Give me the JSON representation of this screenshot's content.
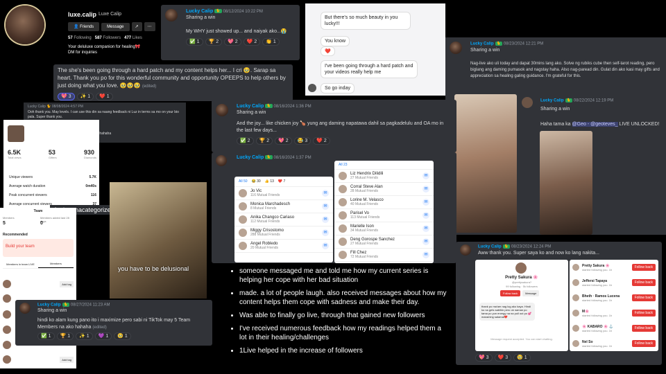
{
  "profile": {
    "handle": "luxe.calip",
    "display_name": "Luxe Calip",
    "friends_btn": "Friends",
    "message_btn": "Message",
    "following_count": "57",
    "following_label": "Following",
    "followers_count": "587",
    "followers_label": "Followers",
    "likes_count": "477",
    "likes_label": "Likes",
    "bio_line1": "Your deluluxe companion for healing🎀",
    "bio_line2": "DM for inquiries"
  },
  "comment1": {
    "text": "The she's been going through a hard patch and my content helps her... I cri 🥹. Sarap sa heart. Thank you po for this wonderful community and opportunity OPEEPS to help others by just doing what you love. 🥹🥹🥹",
    "edited": "(edited)",
    "reactions": [
      "💖 3",
      "✨ 1",
      "❤️ 1"
    ]
  },
  "post_top": {
    "user": "Lucky Calip",
    "badge": "🐈",
    "time": "08/12/2024 10:22 PM",
    "line1": "Sharing a win",
    "line2": "My WHY just showed up... and naiyak ako...😭",
    "reactions": [
      "✅ 1",
      "🏆 2",
      "💖 2",
      "❤️ 2",
      "👏 1"
    ]
  },
  "chat_white": {
    "msg1": "But there's so much beauty in you lucky!!!",
    "msg2": "You know",
    "msg3": "❤️",
    "msg4": "I've been going through a hard patch and your videos really help me",
    "msg5": "So go inday"
  },
  "post_right1": {
    "user": "Lucky Calip",
    "badge": "🐈",
    "time": "08/23/2024 12:21 PM",
    "line1": "Sharing a win",
    "line2": "Nag-live ako uli today and dapat 30mins lang ako. Solve ng rubiks cube then self-tarot reading, pero biglang ang daming pumasok and nagstay haha. Also nag-paread din. Gulat din ako kasi may gifts and appreciation sa healing galing guidance. I'm grateful for this."
  },
  "post_right2": {
    "user": "Lucky Calip",
    "badge": "🐈",
    "time": "08/22/2024 12:19 PM",
    "line1": "Sharing a win",
    "line2_a": "Haha tama ka ",
    "mention": "@Geo - @geoteves_",
    "line2_b": " LIVE UNLOCKED!"
  },
  "small_comment": {
    "title": "Lucky Calip 🐈 08/08/2024 4:57 PM",
    "line1": "Ooh thank you. May levels. I can use this din sa naang feedback ni Luz in terms sa mo on your bio pala. Super thank you.",
    "line2": "Sharing a win",
    "line3": "August thank you Live hahaha ganadong 3hrs hahaha"
  },
  "analytics": {
    "views": "6.5K",
    "views_label": "Total views",
    "gifters": "53",
    "gifters_label": "Gifters",
    "diamonds": "930",
    "diamonds_label": "Diamonds",
    "rows": [
      {
        "k": "Unique viewers",
        "v": "5.7K"
      },
      {
        "k": "Average watch duration",
        "v": "0m40s"
      },
      {
        "k": "Peak concurrent viewers",
        "v": "116"
      },
      {
        "k": "Average concurrent viewers",
        "v": "37"
      }
    ]
  },
  "delulu_caption": "And na nacategorize ka ring \"delulu\" hahaha",
  "team": {
    "title": "Team",
    "left_label": "Members",
    "left_value": "5",
    "right_label": "Members added last 28 days",
    "right_value": "0",
    "recommended": "Recommended",
    "build": "Build your team",
    "tab1": "Members in team LIVE",
    "tab2": "Members",
    "add_tag": "Add tag"
  },
  "video_caption": "you have to be delusional",
  "post_mid1": {
    "user": "Lucky Calip",
    "badge": "🐈",
    "time": "08/16/2024 1:36 PM",
    "line1": "Sharing a win",
    "line2": "And the joy... like chicken joy 🍗 yung ang daming napatawa dahil sa pagkadelulu and OA mo in the last few days...",
    "reactions": [
      "✅ 2",
      "🏆 2",
      "💖 2",
      "😂 3",
      "❤️ 2"
    ]
  },
  "post_mid2": {
    "user": "Lucky Calip",
    "badge": "🐈",
    "time": "08/16/2024 1:37 PM"
  },
  "fb_reacts": {
    "tabs": [
      "All 50",
      "😂 30",
      "👍 13",
      "❤️ 7"
    ],
    "left": [
      {
        "n": "Jo Vic",
        "m": "116 Mutual Friends"
      },
      {
        "n": "Monica Marchadesch",
        "m": "8 Mutual Friends"
      },
      {
        "n": "Anika Changco Cariaso",
        "m": "112 Mutual Friends"
      },
      {
        "n": "Miggy Crisostomo",
        "m": "288 Mutual Friends"
      },
      {
        "n": "Angel Robledo",
        "m": "20 Mutual Friends"
      }
    ],
    "right_tab": "All 23",
    "right": [
      {
        "n": "Liz Hendrix Dilidili",
        "m": "27 Mutual Friends"
      },
      {
        "n": "Corral Steve Alan",
        "m": "28 Mutual Friends"
      },
      {
        "n": "Lorine M. Velasco",
        "m": "40 Mutual Friends"
      },
      {
        "n": "Parisel Vo",
        "m": "113 Mutual Friends"
      },
      {
        "n": "Marielle Ison",
        "m": "34 Mutual Friends"
      },
      {
        "n": "Deng Gorospe Sanchez",
        "m": "27 Mutual Friends"
      },
      {
        "n": "Fill Chez",
        "m": "72 Mutual Friends"
      }
    ]
  },
  "bullets": [
    "someone messaged me and told me how my current series is helping her cope with her bad situation",
    "made. a lot of people laugh. also received messages about how my content helps them cope with sadness and make their day.",
    "Was able to finally go live, through that gained new followers",
    "I've received numerous feedback how my readings helped them a lot in their healing/challenges",
    "1Live helped in the increase of followers"
  ],
  "post_bottom": {
    "user": "Lucky Calip",
    "badge": "🐈",
    "time": "08/27/2024 11:23 AM",
    "line1": "Sharing a win",
    "line2": "hindi ko alam kung pano ito i maximize pero sabi ni TikTok may 5 Team Members na ako hahaha",
    "edited": "(edited)",
    "reactions": [
      "✅ 1",
      "🏆 1",
      "✨ 1",
      "💜 1",
      "🥹 1"
    ]
  },
  "post_right3": {
    "user": "Lucky Calip",
    "badge": "🐈",
    "time": "08/23/2024 12:24 PM",
    "line1": "Aww thank you. Super saya ko and now ko lang nakita...",
    "reactions": [
      "💖 3",
      "❤️ 3",
      "🥹 1"
    ]
  },
  "pretty": {
    "name": "Pretty Sakura 🌸",
    "handle": "@prettysakura?",
    "stats": "99 following · 5k followers",
    "btn1": "Follow back",
    "btn2": "Message",
    "chat": "thank po ma'am nag log ako kaya. Hindi ko na gets sabihin pero ok naman po tama po yun energy na na pull out po 💕 maraming salamat❤️",
    "note": "Message request accepted. You can start chatting.",
    "followers": [
      {
        "n": "Pretty Sakura 🌸",
        "s": "started following you. 1h"
      },
      {
        "n": "Jeffersi Tapaya",
        "s": "started following you. 1h"
      },
      {
        "n": "Bheth · Ramos Lucena",
        "s": "started following you. 1h"
      },
      {
        "n": "M🌸",
        "s": "started following you. 1h"
      },
      {
        "n": "🌸 KABARO 🌸 ⚓",
        "s": "started following you. 1h"
      },
      {
        "n": "Nel So",
        "s": "started following you. 1h"
      }
    ],
    "follow_back": "Follow back"
  }
}
